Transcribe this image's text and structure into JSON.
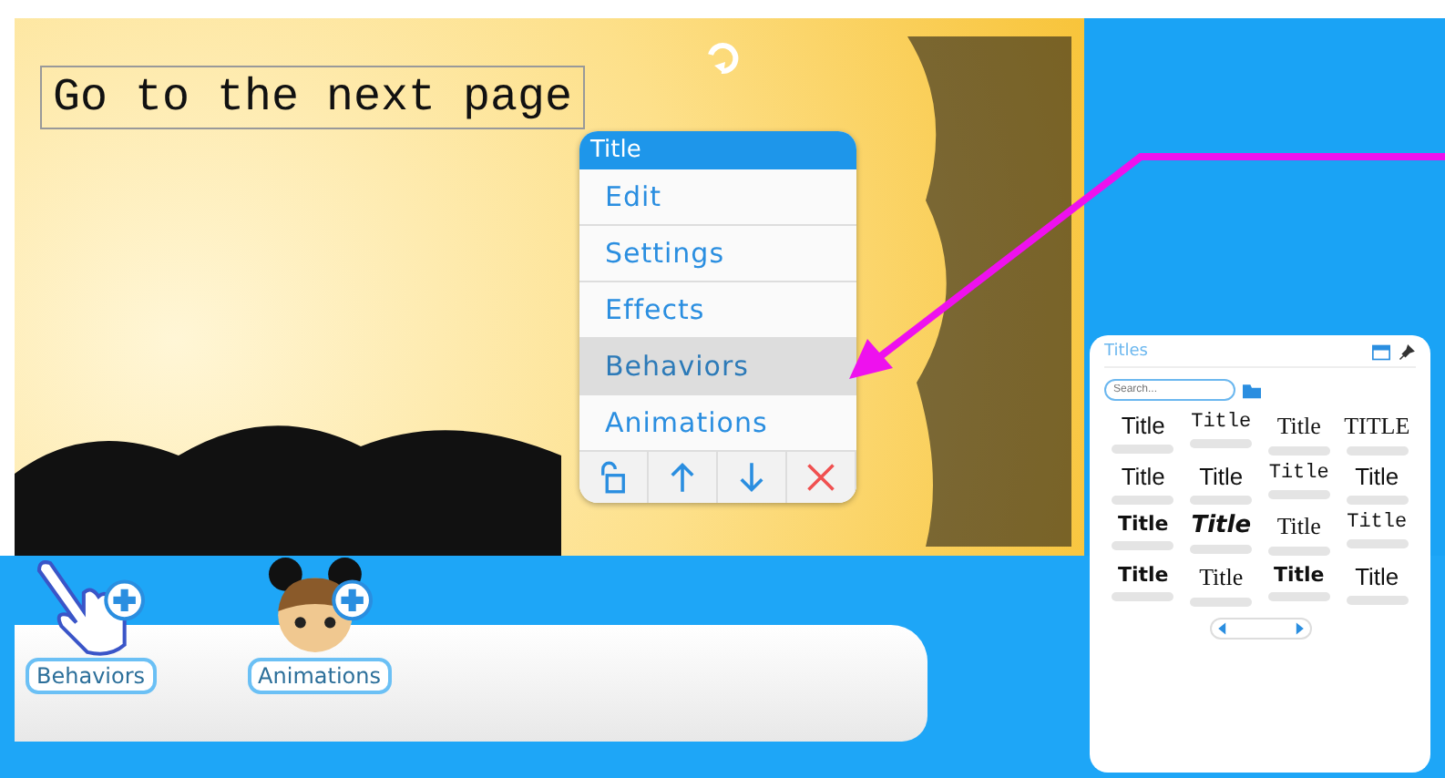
{
  "canvas": {
    "text_box": {
      "text": "Go to the next page"
    }
  },
  "context_menu": {
    "title": "Title",
    "items": [
      {
        "label": "Edit",
        "selected": false
      },
      {
        "label": "Settings",
        "selected": false
      },
      {
        "label": "Effects",
        "selected": false
      },
      {
        "label": "Behaviors",
        "selected": true
      },
      {
        "label": "Animations",
        "selected": false
      }
    ],
    "toolbar": [
      {
        "kind": "lock"
      },
      {
        "kind": "up"
      },
      {
        "kind": "down"
      },
      {
        "kind": "delete"
      }
    ]
  },
  "shelf": [
    {
      "kind": "hand",
      "label": "Behaviors"
    },
    {
      "kind": "face",
      "label": "Animations"
    }
  ],
  "titles_panel": {
    "title": "Titles",
    "search": {
      "placeholder": "Search..."
    },
    "samples": [
      {
        "text": "Title",
        "kind": "sans"
      },
      {
        "text": "Title",
        "kind": "mono"
      },
      {
        "text": "Title",
        "kind": "serif"
      },
      {
        "text": "TITLE",
        "kind": "serif"
      },
      {
        "text": "Title",
        "kind": "sans"
      },
      {
        "text": "Title",
        "kind": "sans"
      },
      {
        "text": "Title",
        "kind": "mono"
      },
      {
        "text": "Title",
        "kind": "sans"
      },
      {
        "text": "Title",
        "kind": "bold"
      },
      {
        "text": "Title",
        "kind": "italic"
      },
      {
        "text": "Title",
        "kind": "serif"
      },
      {
        "text": "Title",
        "kind": "mono"
      },
      {
        "text": "Title",
        "kind": "bold"
      },
      {
        "text": "Title",
        "kind": "serif"
      },
      {
        "text": "Title",
        "kind": "bold"
      },
      {
        "text": "Title",
        "kind": "sans"
      }
    ]
  }
}
